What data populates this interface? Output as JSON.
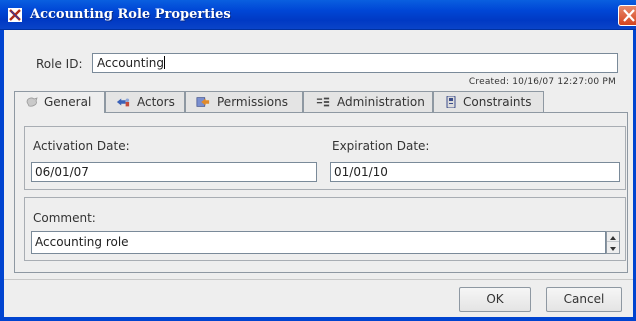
{
  "window": {
    "title": "Accounting Role Properties",
    "title_icon": "app-x-icon",
    "close_icon": "close-x-icon"
  },
  "role": {
    "id_label": "Role ID:",
    "id_value": "Accounting",
    "created": "Created: 10/16/07 12:27:00 PM"
  },
  "tabs": [
    {
      "label": "General",
      "icon": "general-icon",
      "active": true
    },
    {
      "label": "Actors",
      "icon": "actors-icon",
      "active": false
    },
    {
      "label": "Permissions",
      "icon": "permissions-icon",
      "active": false
    },
    {
      "label": "Administration",
      "icon": "administration-icon",
      "active": false
    },
    {
      "label": "Constraints",
      "icon": "constraints-icon",
      "active": false
    }
  ],
  "general": {
    "activation_label": "Activation Date:",
    "activation_value": "06/01/07",
    "expiration_label": "Expiration Date:",
    "expiration_value": "01/01/10",
    "comment_label": "Comment:",
    "comment_value": "Accounting role"
  },
  "buttons": {
    "ok": "OK",
    "cancel": "Cancel"
  },
  "colors": {
    "titlebar": "#0047d6",
    "close": "#d4441f",
    "panel": "#eeeeee"
  }
}
